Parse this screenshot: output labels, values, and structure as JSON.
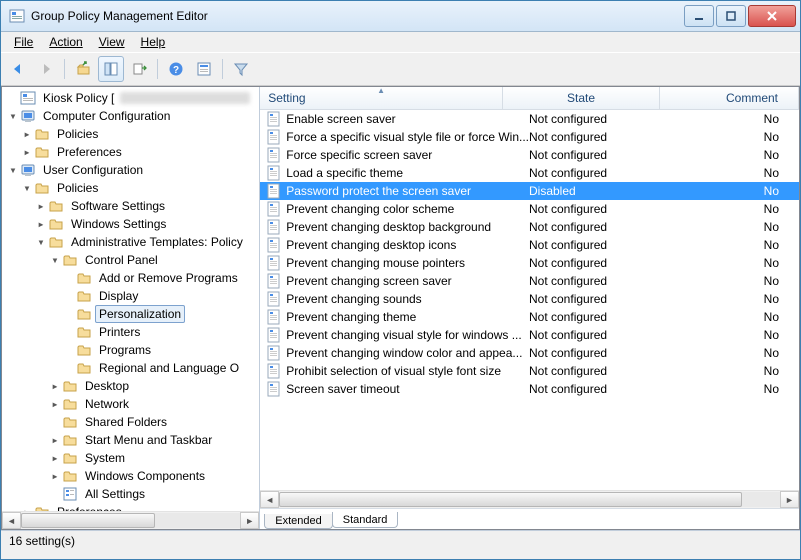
{
  "window": {
    "title": "Group Policy Management Editor"
  },
  "menubar": [
    "File",
    "Action",
    "View",
    "Help"
  ],
  "toolbar_icons": [
    "back",
    "forward",
    "up",
    "frame",
    "export",
    "help",
    "properties",
    "filter"
  ],
  "tree": [
    {
      "d": 1,
      "t": "root",
      "exp": "",
      "label": "Kiosk Policy [",
      "blur": true
    },
    {
      "d": 1,
      "t": "comp",
      "exp": "▾",
      "label": "Computer Configuration"
    },
    {
      "d": 2,
      "t": "folder",
      "exp": "▸",
      "label": "Policies"
    },
    {
      "d": 2,
      "t": "folder",
      "exp": "▸",
      "label": "Preferences"
    },
    {
      "d": 1,
      "t": "user",
      "exp": "▾",
      "label": "User Configuration"
    },
    {
      "d": 2,
      "t": "folder",
      "exp": "▾",
      "label": "Policies"
    },
    {
      "d": 3,
      "t": "folder",
      "exp": "▸",
      "label": "Software Settings"
    },
    {
      "d": 3,
      "t": "folder",
      "exp": "▸",
      "label": "Windows Settings"
    },
    {
      "d": 3,
      "t": "folder",
      "exp": "▾",
      "label": "Administrative Templates: Policy"
    },
    {
      "d": 4,
      "t": "folder",
      "exp": "▾",
      "label": "Control Panel"
    },
    {
      "d": 5,
      "t": "folder",
      "exp": "",
      "label": "Add or Remove Programs"
    },
    {
      "d": 5,
      "t": "folder",
      "exp": "",
      "label": "Display"
    },
    {
      "d": 5,
      "t": "folder",
      "exp": "",
      "label": "Personalization",
      "sel": true
    },
    {
      "d": 5,
      "t": "folder",
      "exp": "",
      "label": "Printers"
    },
    {
      "d": 5,
      "t": "folder",
      "exp": "",
      "label": "Programs"
    },
    {
      "d": 5,
      "t": "folder",
      "exp": "",
      "label": "Regional and Language O"
    },
    {
      "d": 4,
      "t": "folder",
      "exp": "▸",
      "label": "Desktop"
    },
    {
      "d": 4,
      "t": "folder",
      "exp": "▸",
      "label": "Network"
    },
    {
      "d": 4,
      "t": "folder",
      "exp": "",
      "label": "Shared Folders"
    },
    {
      "d": 4,
      "t": "folder",
      "exp": "▸",
      "label": "Start Menu and Taskbar"
    },
    {
      "d": 4,
      "t": "folder",
      "exp": "▸",
      "label": "System"
    },
    {
      "d": 4,
      "t": "folder",
      "exp": "▸",
      "label": "Windows Components"
    },
    {
      "d": 4,
      "t": "allset",
      "exp": "",
      "label": "All Settings"
    },
    {
      "d": 2,
      "t": "folder",
      "exp": "▸",
      "label": "Preferences"
    }
  ],
  "columns": {
    "setting": "Setting",
    "state": "State",
    "comment": "Comment"
  },
  "rows": [
    {
      "s": "Enable screen saver",
      "st": "Not configured",
      "c": "No"
    },
    {
      "s": "Force a specific visual style file or force Win...",
      "st": "Not configured",
      "c": "No"
    },
    {
      "s": "Force specific screen saver",
      "st": "Not configured",
      "c": "No"
    },
    {
      "s": "Load a specific theme",
      "st": "Not configured",
      "c": "No"
    },
    {
      "s": "Password protect the screen saver",
      "st": "Disabled",
      "c": "No",
      "sel": true
    },
    {
      "s": "Prevent changing color scheme",
      "st": "Not configured",
      "c": "No"
    },
    {
      "s": "Prevent changing desktop background",
      "st": "Not configured",
      "c": "No"
    },
    {
      "s": "Prevent changing desktop icons",
      "st": "Not configured",
      "c": "No"
    },
    {
      "s": "Prevent changing mouse pointers",
      "st": "Not configured",
      "c": "No"
    },
    {
      "s": "Prevent changing screen saver",
      "st": "Not configured",
      "c": "No"
    },
    {
      "s": "Prevent changing sounds",
      "st": "Not configured",
      "c": "No"
    },
    {
      "s": "Prevent changing theme",
      "st": "Not configured",
      "c": "No"
    },
    {
      "s": "Prevent changing visual style for windows ...",
      "st": "Not configured",
      "c": "No"
    },
    {
      "s": "Prevent changing window color and appea...",
      "st": "Not configured",
      "c": "No"
    },
    {
      "s": "Prohibit selection of visual style font size",
      "st": "Not configured",
      "c": "No"
    },
    {
      "s": "Screen saver timeout",
      "st": "Not configured",
      "c": "No"
    }
  ],
  "tabs": [
    "Extended",
    "Standard"
  ],
  "active_tab": 1,
  "status": "16 setting(s)"
}
